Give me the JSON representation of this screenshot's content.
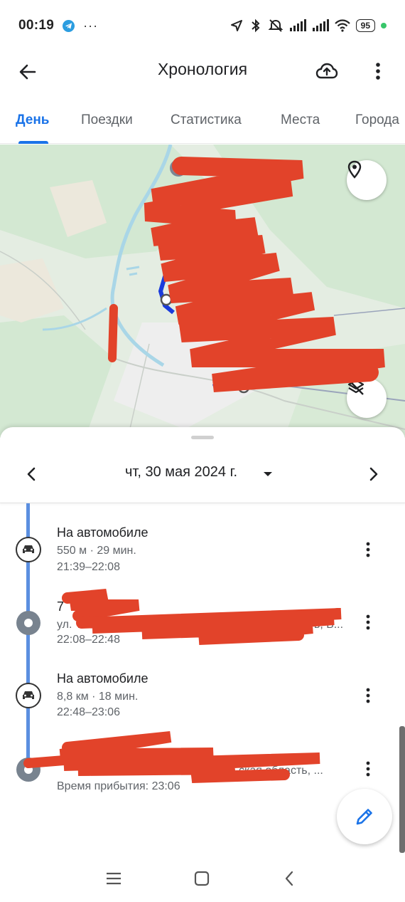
{
  "status_bar": {
    "time": "00:19",
    "more_notifications": "···",
    "battery": "95"
  },
  "app_bar": {
    "title": "Хронология"
  },
  "tabs": [
    {
      "label": "День",
      "active": true
    },
    {
      "label": "Поездки",
      "active": false
    },
    {
      "label": "Статистика",
      "active": false
    },
    {
      "label": "Места",
      "active": false
    },
    {
      "label": "Города",
      "active": false
    }
  ],
  "date_nav": {
    "date": "чт, 30 мая 2024 г."
  },
  "timeline": [
    {
      "type": "drive",
      "title": "На автомобиле",
      "subtitle": "550 м · 29 мин.",
      "time": "21:39–22:08"
    },
    {
      "type": "place",
      "title": "7",
      "address": "ул. Табл",
      "address_end": "ь, Б...",
      "time": "22:08–22:48"
    },
    {
      "type": "drive",
      "title": "На автомобиле",
      "subtitle": "8,8 км · 18 мин.",
      "time": "22:48–23:06"
    },
    {
      "type": "place",
      "title": "",
      "address": "ская область, ...",
      "time": "Время прибытия: 23:06"
    }
  ],
  "colors": {
    "accent": "#1a73e8",
    "timeline": "#5b8fe0",
    "redaction": "#e2432a",
    "map_green": "#d3e8d2",
    "map_water": "#a9d6e7"
  },
  "icons": {
    "back": "arrow-left-icon",
    "upload": "cloud-upload-icon",
    "more": "more-vert-icon",
    "location": "map-pin-icon",
    "layers": "layers-off-icon",
    "edit": "pencil-icon",
    "car": "car-icon"
  }
}
